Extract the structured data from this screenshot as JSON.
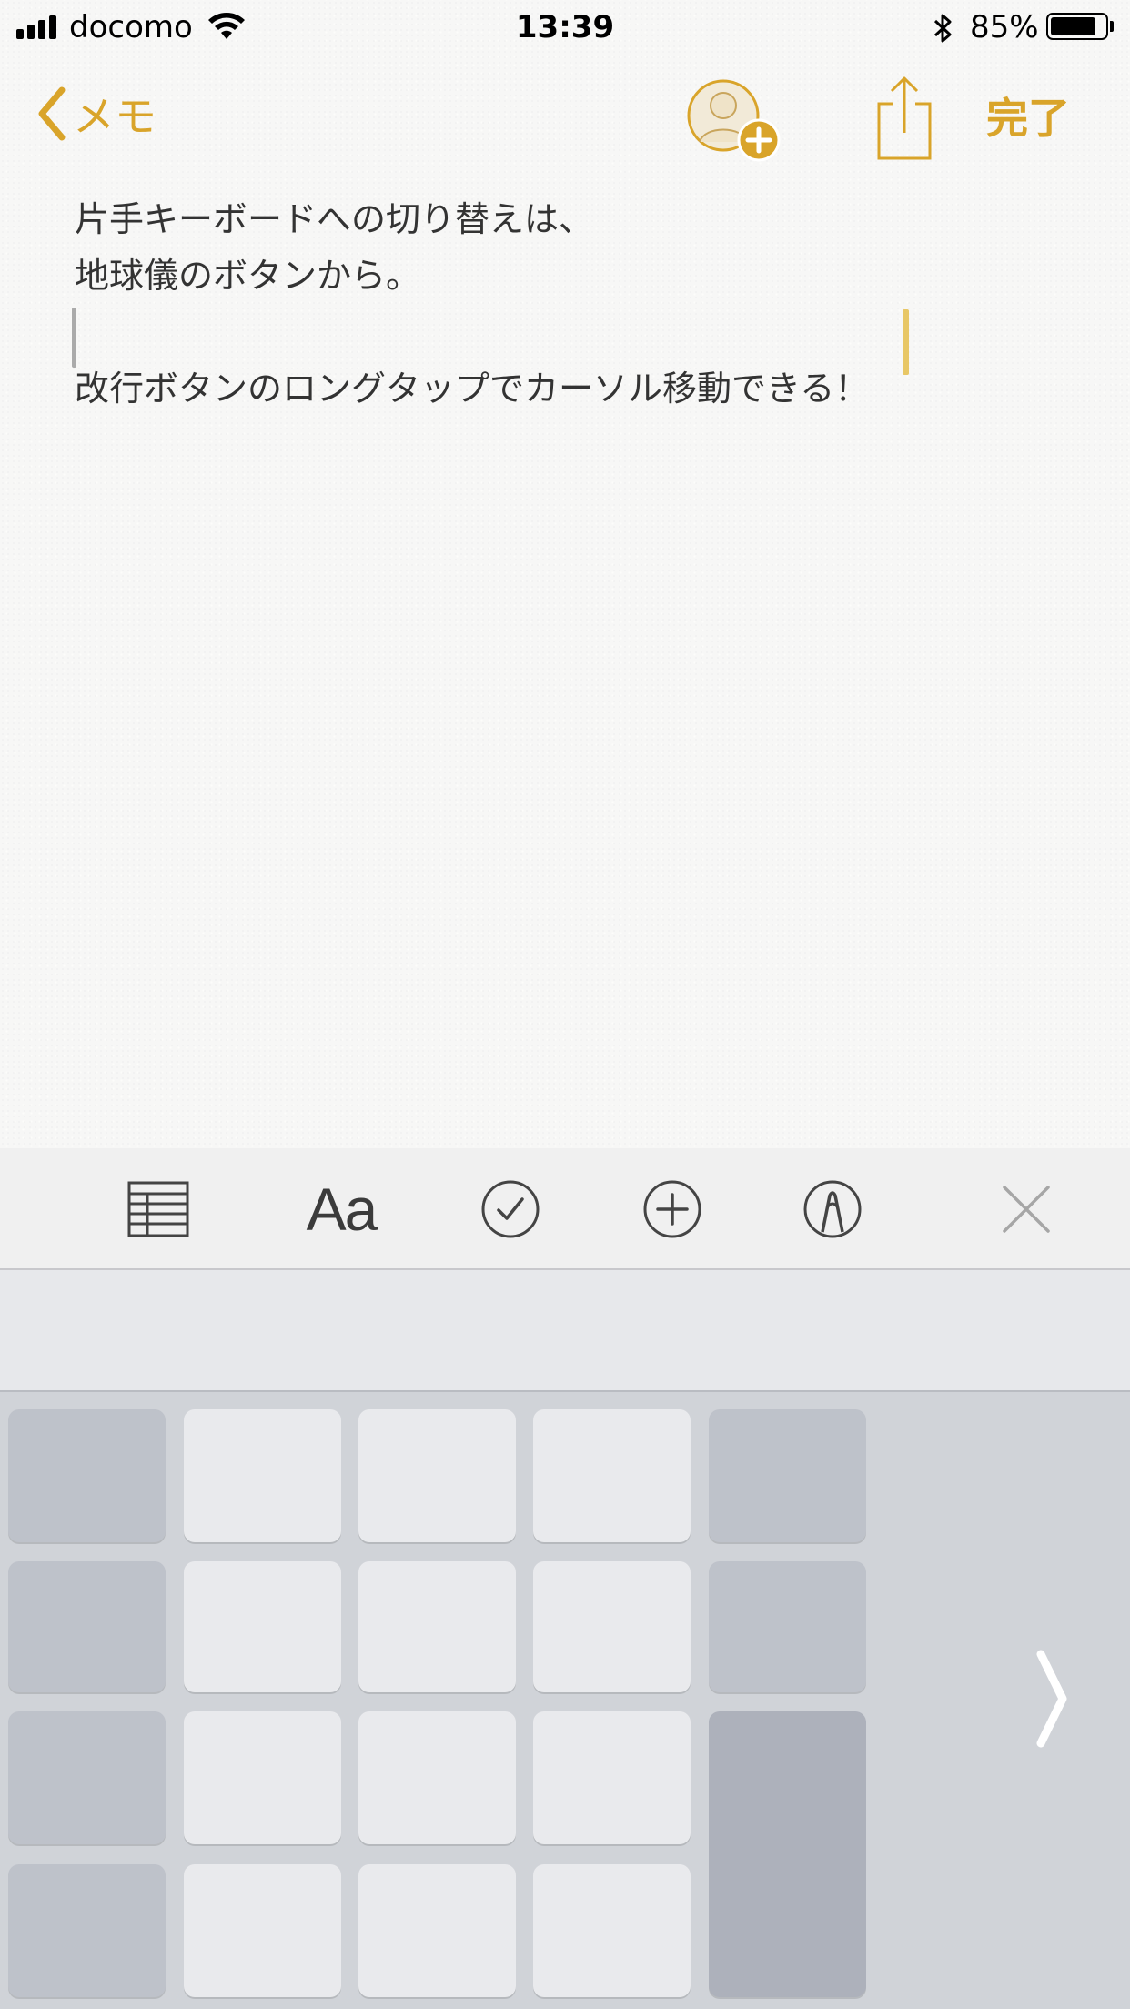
{
  "status_bar": {
    "carrier": "docomo",
    "time": "13:39",
    "battery_percent": "85%",
    "battery_level": 0.85,
    "signal_bars": 4,
    "icons": [
      "signal-icon",
      "wifi-icon",
      "bluetooth-icon",
      "battery-icon"
    ]
  },
  "nav": {
    "back_label": "メモ",
    "done_label": "完了",
    "icons": [
      "chevron-left-icon",
      "add-person-icon",
      "share-icon"
    ]
  },
  "note": {
    "lines": [
      "片手キーボードへの切り替えは、",
      "地球儀のボタンから。",
      "",
      "改行ボタンのロングタップでカーソル移動できる！"
    ]
  },
  "toolbar": {
    "format_label": "Aa",
    "icons": [
      "table-icon",
      "format-text-icon",
      "checklist-icon",
      "add-icon",
      "markup-icon",
      "close-icon"
    ]
  },
  "keyboard": {
    "mode": "one-handed-left",
    "icons": [
      "chevron-right-icon"
    ]
  },
  "colors": {
    "accent": "#d9a42a",
    "note_background": "#f7f7f6",
    "keyboard_background": "#d0d3d8",
    "text": "#333333"
  }
}
